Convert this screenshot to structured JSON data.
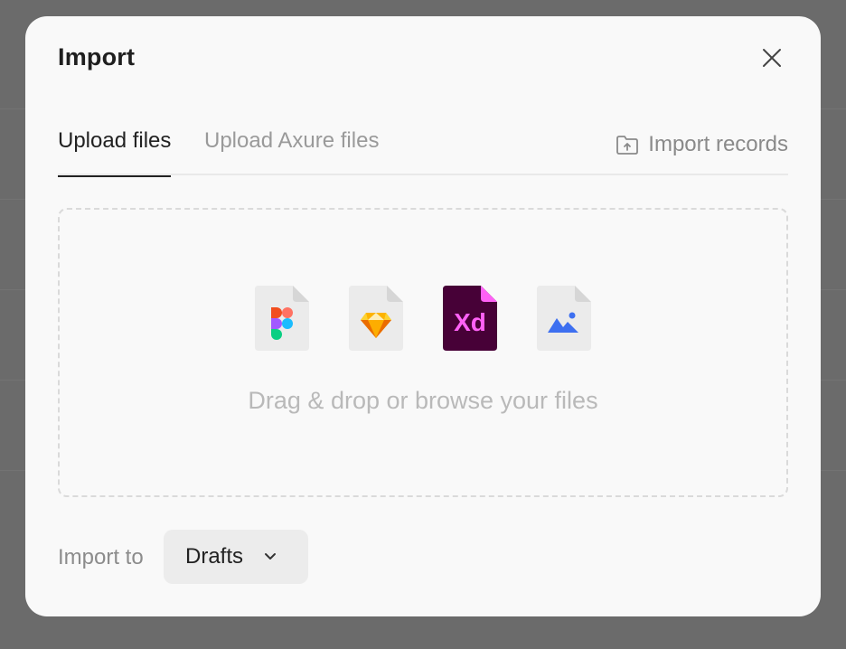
{
  "dialog": {
    "title": "Import"
  },
  "tabs": [
    {
      "label": "Upload files",
      "active": true
    },
    {
      "label": "Upload Axure files",
      "active": false
    }
  ],
  "records_link": {
    "label": "Import records",
    "icon": "folder-upload-icon"
  },
  "dropzone": {
    "text": "Drag & drop or browse your files",
    "file_types": [
      {
        "icon": "figma-file-icon"
      },
      {
        "icon": "sketch-file-icon"
      },
      {
        "icon": "xd-file-icon",
        "label": "Xd"
      },
      {
        "icon": "image-file-icon"
      }
    ]
  },
  "import_to": {
    "label": "Import to",
    "selected": "Drafts"
  },
  "colors": {
    "overlay": "#6b6b6b",
    "modal_bg": "#f9f9f9",
    "xd_purple": "#470137",
    "xd_pink": "#ff61f6",
    "image_blue": "#3d6ff0"
  }
}
